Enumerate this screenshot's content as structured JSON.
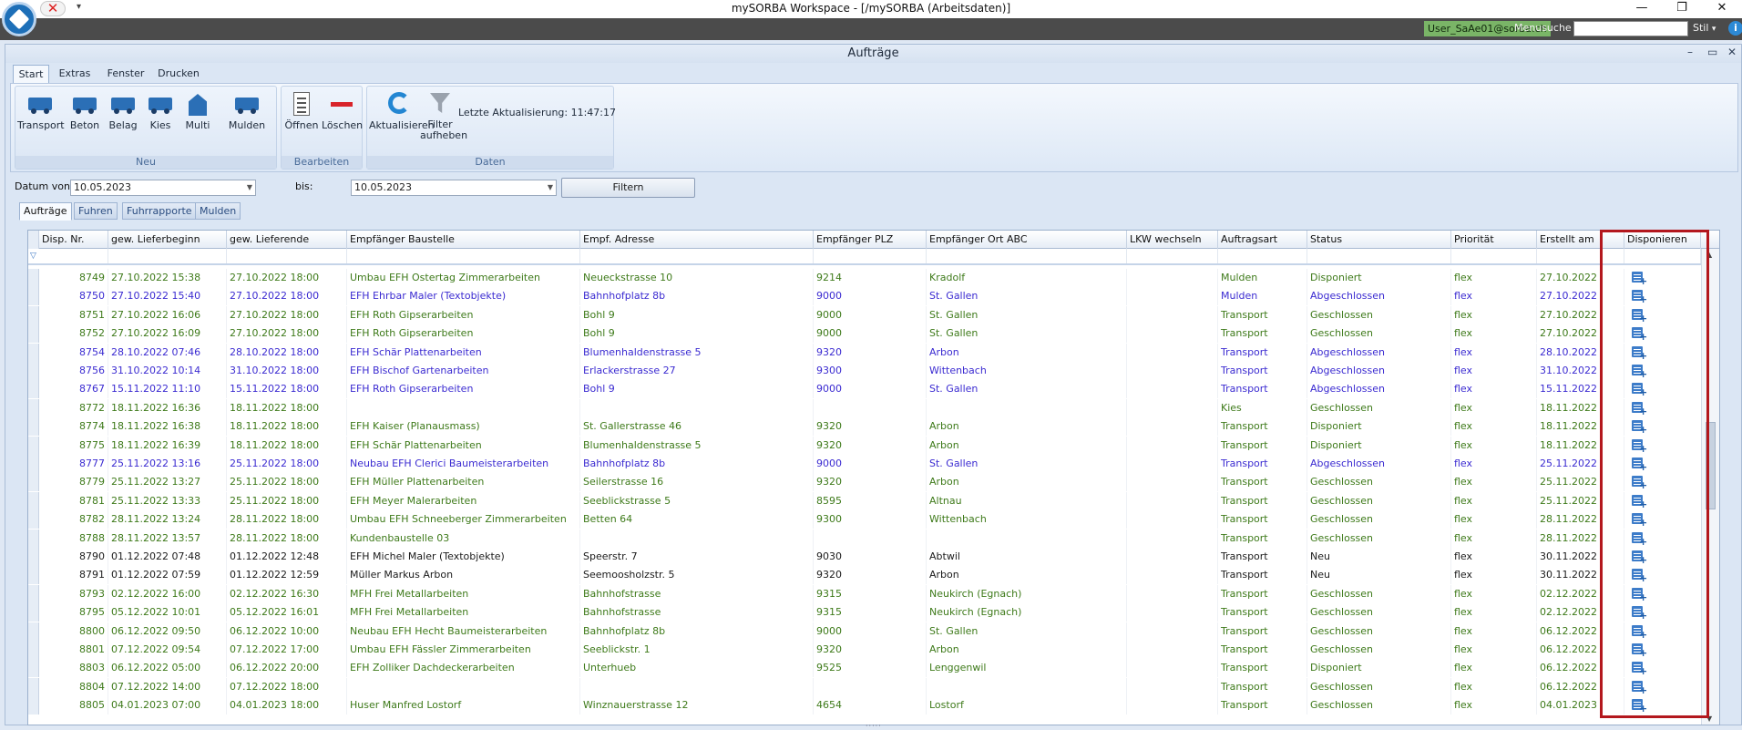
{
  "app": {
    "window_title": "mySORBA Workspace - [/mySORBA (Arbeitsdaten)]",
    "qa_dropdown": "▾",
    "user": "User_SaAe01@sorba.ch",
    "menusuche_label": "Menusuche",
    "stil_label": "Stil",
    "stil_dropdown": "▾"
  },
  "inner_window": {
    "title": "Aufträge"
  },
  "ribbon": {
    "tabs": [
      "Start",
      "Extras",
      "Fenster",
      "Drucken"
    ],
    "groups": {
      "neu": {
        "label": "Neu",
        "buttons": [
          "Transport",
          "Beton",
          "Belag",
          "Kies",
          "Multi",
          "Mulden"
        ]
      },
      "bearbeiten": {
        "label": "Bearbeiten",
        "buttons": [
          "Öffnen",
          "Löschen"
        ]
      },
      "daten": {
        "label": "Daten",
        "buttons": [
          "Aktualisieren",
          "Filter aufheben"
        ],
        "last_update": "Letzte Aktualisierung:   11:47:17"
      }
    }
  },
  "filter": {
    "datum_von_label": "Datum von:",
    "datum_von_value": "10.05.2023",
    "bis_label": "bis:",
    "bis_value": "10.05.2023",
    "button": "Filtern"
  },
  "content_tabs": [
    "Aufträge",
    "Fuhren",
    "Fuhrrapporte",
    "Mulden"
  ],
  "grid": {
    "columns": [
      "Disp. Nr.",
      "gew. Lieferbeginn",
      "gew. Lieferende",
      "Empfänger Baustelle",
      "Empf. Adresse",
      "Empfänger PLZ",
      "Empfänger Ort ABC",
      "LKW wechseln",
      "Auftragsart",
      "Status",
      "Priorität",
      "Erstellt am",
      "Disponieren"
    ],
    "rows": [
      {
        "nr": "8749",
        "begin": "27.10.2022 15:38",
        "ende": "27.10.2022 18:00",
        "baustelle": "Umbau EFH Ostertag Zimmerarbeiten",
        "adresse": "Neueckstrasse 10",
        "plz": "9214",
        "ort": "Kradolf",
        "lkw": "",
        "art": "Mulden",
        "status": "Disponiert",
        "prio": "flex",
        "erstellt": "27.10.2022",
        "color": "green"
      },
      {
        "nr": "8750",
        "begin": "27.10.2022 15:40",
        "ende": "27.10.2022 18:00",
        "baustelle": "EFH Ehrbar Maler (Textobjekte)",
        "adresse": "Bahnhofplatz 8b",
        "plz": "9000",
        "ort": "St. Gallen",
        "lkw": "",
        "art": "Mulden",
        "status": "Abgeschlossen",
        "prio": "flex",
        "erstellt": "27.10.2022",
        "color": "blue"
      },
      {
        "nr": "8751",
        "begin": "27.10.2022 16:06",
        "ende": "27.10.2022 18:00",
        "baustelle": "EFH Roth Gipserarbeiten",
        "adresse": "Bohl 9",
        "plz": "9000",
        "ort": "St. Gallen",
        "lkw": "",
        "art": "Transport",
        "status": "Geschlossen",
        "prio": "flex",
        "erstellt": "27.10.2022",
        "color": "green"
      },
      {
        "nr": "8752",
        "begin": "27.10.2022 16:09",
        "ende": "27.10.2022 18:00",
        "baustelle": "EFH Roth Gipserarbeiten",
        "adresse": "Bohl 9",
        "plz": "9000",
        "ort": "St. Gallen",
        "lkw": "",
        "art": "Transport",
        "status": "Geschlossen",
        "prio": "flex",
        "erstellt": "27.10.2022",
        "color": "green"
      },
      {
        "nr": "8754",
        "begin": "28.10.2022 07:46",
        "ende": "28.10.2022 18:00",
        "baustelle": "EFH Schär Plattenarbeiten",
        "adresse": "Blumenhaldenstrasse 5",
        "plz": "9320",
        "ort": "Arbon",
        "lkw": "",
        "art": "Transport",
        "status": "Abgeschlossen",
        "prio": "flex",
        "erstellt": "28.10.2022",
        "color": "blue"
      },
      {
        "nr": "8756",
        "begin": "31.10.2022 10:14",
        "ende": "31.10.2022 18:00",
        "baustelle": "EFH Bischof Gartenarbeiten",
        "adresse": "Erlackerstrasse 27",
        "plz": "9300",
        "ort": "Wittenbach",
        "lkw": "",
        "art": "Transport",
        "status": "Abgeschlossen",
        "prio": "flex",
        "erstellt": "31.10.2022",
        "color": "blue"
      },
      {
        "nr": "8767",
        "begin": "15.11.2022 11:10",
        "ende": "15.11.2022 18:00",
        "baustelle": "EFH Roth Gipserarbeiten",
        "adresse": "Bohl 9",
        "plz": "9000",
        "ort": "St. Gallen",
        "lkw": "",
        "art": "Transport",
        "status": "Abgeschlossen",
        "prio": "flex",
        "erstellt": "15.11.2022",
        "color": "blue"
      },
      {
        "nr": "8772",
        "begin": "18.11.2022 16:36",
        "ende": "18.11.2022 18:00",
        "baustelle": "",
        "adresse": "",
        "plz": "",
        "ort": "",
        "lkw": "",
        "art": "Kies",
        "status": "Geschlossen",
        "prio": "flex",
        "erstellt": "18.11.2022",
        "color": "green"
      },
      {
        "nr": "8774",
        "begin": "18.11.2022 16:38",
        "ende": "18.11.2022 18:00",
        "baustelle": "EFH Kaiser (Planausmass)",
        "adresse": "St. Gallerstrasse 46",
        "plz": "9320",
        "ort": "Arbon",
        "lkw": "",
        "art": "Transport",
        "status": "Disponiert",
        "prio": "flex",
        "erstellt": "18.11.2022",
        "color": "green"
      },
      {
        "nr": "8775",
        "begin": "18.11.2022 16:39",
        "ende": "18.11.2022 18:00",
        "baustelle": "EFH Schär Plattenarbeiten",
        "adresse": "Blumenhaldenstrasse 5",
        "plz": "9320",
        "ort": "Arbon",
        "lkw": "",
        "art": "Transport",
        "status": "Disponiert",
        "prio": "flex",
        "erstellt": "18.11.2022",
        "color": "green"
      },
      {
        "nr": "8777",
        "begin": "25.11.2022 13:16",
        "ende": "25.11.2022 18:00",
        "baustelle": "Neubau EFH Clerici Baumeisterarbeiten",
        "adresse": "Bahnhofplatz 8b",
        "plz": "9000",
        "ort": "St. Gallen",
        "lkw": "",
        "art": "Transport",
        "status": "Abgeschlossen",
        "prio": "flex",
        "erstellt": "25.11.2022",
        "color": "blue"
      },
      {
        "nr": "8779",
        "begin": "25.11.2022 13:27",
        "ende": "25.11.2022 18:00",
        "baustelle": "EFH Müller Plattenarbeiten",
        "adresse": "Seilerstrasse 16",
        "plz": "9320",
        "ort": "Arbon",
        "lkw": "",
        "art": "Transport",
        "status": "Geschlossen",
        "prio": "flex",
        "erstellt": "25.11.2022",
        "color": "green"
      },
      {
        "nr": "8781",
        "begin": "25.11.2022 13:33",
        "ende": "25.11.2022 18:00",
        "baustelle": "EFH Meyer Malerarbeiten",
        "adresse": "Seeblickstrasse 5",
        "plz": "8595",
        "ort": "Altnau",
        "lkw": "",
        "art": "Transport",
        "status": "Geschlossen",
        "prio": "flex",
        "erstellt": "25.11.2022",
        "color": "green"
      },
      {
        "nr": "8782",
        "begin": "28.11.2022 13:24",
        "ende": "28.11.2022 18:00",
        "baustelle": "Umbau EFH Schneeberger Zimmerarbeiten",
        "adresse": "Betten 64",
        "plz": "9300",
        "ort": "Wittenbach",
        "lkw": "",
        "art": "Transport",
        "status": "Geschlossen",
        "prio": "flex",
        "erstellt": "28.11.2022",
        "color": "green"
      },
      {
        "nr": "8788",
        "begin": "28.11.2022 13:57",
        "ende": "28.11.2022 18:00",
        "baustelle": "Kundenbaustelle 03",
        "adresse": "",
        "plz": "",
        "ort": "",
        "lkw": "",
        "art": "Transport",
        "status": "Geschlossen",
        "prio": "flex",
        "erstellt": "28.11.2022",
        "color": "green"
      },
      {
        "nr": "8790",
        "begin": "01.12.2022 07:48",
        "ende": "01.12.2022 12:48",
        "baustelle": "EFH Michel Maler (Textobjekte)",
        "adresse": "Speerstr. 7",
        "plz": "9030",
        "ort": "Abtwil",
        "lkw": "",
        "art": "Transport",
        "status": "Neu",
        "prio": "flex",
        "erstellt": "30.11.2022",
        "color": "black"
      },
      {
        "nr": "8791",
        "begin": "01.12.2022 07:59",
        "ende": "01.12.2022 12:59",
        "baustelle": "Müller Markus Arbon",
        "adresse": "Seemoosholzstr. 5",
        "plz": "9320",
        "ort": "Arbon",
        "lkw": "",
        "art": "Transport",
        "status": "Neu",
        "prio": "flex",
        "erstellt": "30.11.2022",
        "color": "black"
      },
      {
        "nr": "8793",
        "begin": "02.12.2022 16:00",
        "ende": "02.12.2022 16:30",
        "baustelle": "MFH Frei Metallarbeiten",
        "adresse": "Bahnhofstrasse",
        "plz": "9315",
        "ort": "Neukirch (Egnach)",
        "lkw": "",
        "art": "Transport",
        "status": "Geschlossen",
        "prio": "flex",
        "erstellt": "02.12.2022",
        "color": "green"
      },
      {
        "nr": "8795",
        "begin": "05.12.2022 10:01",
        "ende": "05.12.2022 16:01",
        "baustelle": "MFH Frei Metallarbeiten",
        "adresse": "Bahnhofstrasse",
        "plz": "9315",
        "ort": "Neukirch (Egnach)",
        "lkw": "",
        "art": "Transport",
        "status": "Geschlossen",
        "prio": "flex",
        "erstellt": "02.12.2022",
        "color": "green"
      },
      {
        "nr": "8800",
        "begin": "06.12.2022 09:50",
        "ende": "06.12.2022 10:00",
        "baustelle": "Neubau EFH Hecht Baumeisterarbeiten",
        "adresse": "Bahnhofplatz 8b",
        "plz": "9000",
        "ort": "St. Gallen",
        "lkw": "",
        "art": "Transport",
        "status": "Geschlossen",
        "prio": "flex",
        "erstellt": "06.12.2022",
        "color": "green"
      },
      {
        "nr": "8801",
        "begin": "07.12.2022 09:54",
        "ende": "07.12.2022 17:00",
        "baustelle": "Umbau EFH Fässler Zimmerarbeiten",
        "adresse": "Seeblickstr. 1",
        "plz": "9320",
        "ort": "Arbon",
        "lkw": "",
        "art": "Transport",
        "status": "Geschlossen",
        "prio": "flex",
        "erstellt": "06.12.2022",
        "color": "green"
      },
      {
        "nr": "8803",
        "begin": "06.12.2022 05:00",
        "ende": "06.12.2022 20:00",
        "baustelle": "EFH Zolliker Dachdeckerarbeiten",
        "adresse": "Unterhueb",
        "plz": "9525",
        "ort": "Lenggenwil",
        "lkw": "",
        "art": "Transport",
        "status": "Disponiert",
        "prio": "flex",
        "erstellt": "06.12.2022",
        "color": "green"
      },
      {
        "nr": "8804",
        "begin": "07.12.2022 14:00",
        "ende": "07.12.2022 18:00",
        "baustelle": "",
        "adresse": "",
        "plz": "",
        "ort": "",
        "lkw": "",
        "art": "Transport",
        "status": "Geschlossen",
        "prio": "flex",
        "erstellt": "06.12.2022",
        "color": "green"
      },
      {
        "nr": "8805",
        "begin": "04.01.2023 07:00",
        "ende": "04.01.2023 18:00",
        "baustelle": "Huser Manfred Lostorf",
        "adresse": "Winznauerstrasse 12",
        "plz": "4654",
        "ort": "Lostorf",
        "lkw": "",
        "art": "Transport",
        "status": "Geschlossen",
        "prio": "flex",
        "erstellt": "04.01.2023",
        "color": "green"
      }
    ]
  }
}
